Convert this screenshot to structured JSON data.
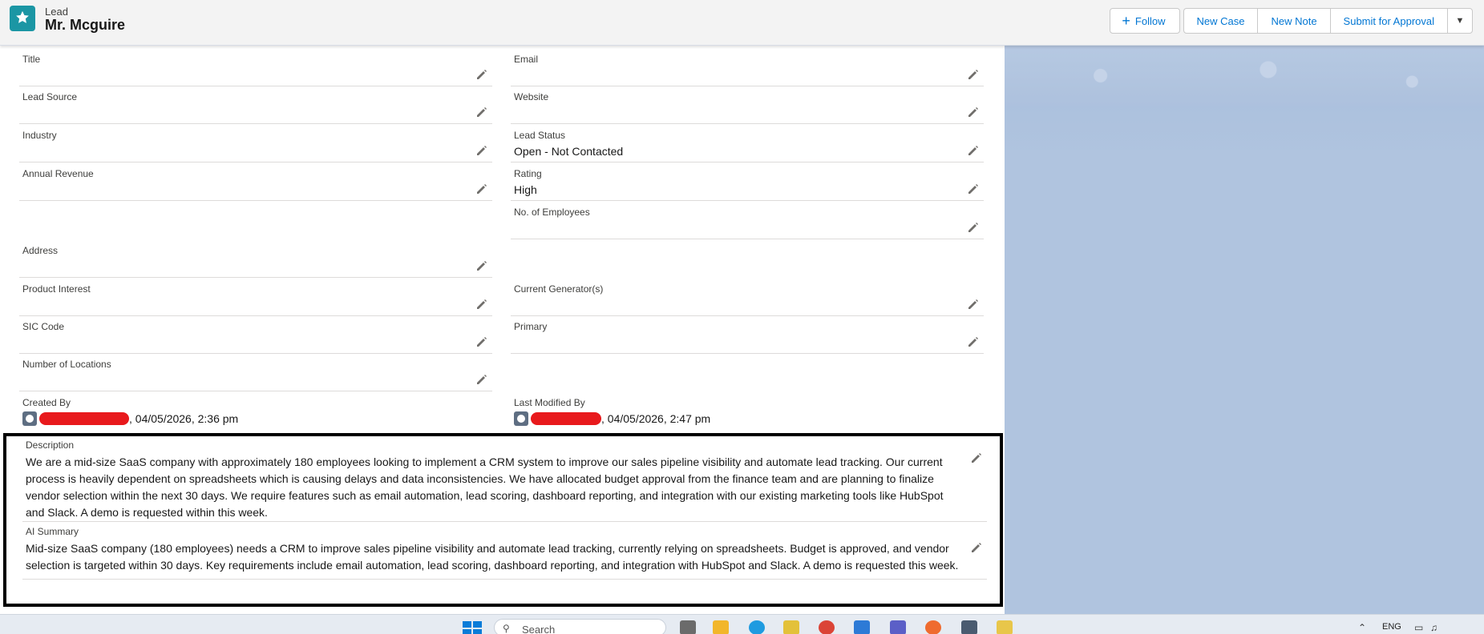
{
  "header": {
    "object_label": "Lead",
    "record_name": "Mr. Mcguire",
    "follow_label": "Follow",
    "new_case_label": "New Case",
    "new_note_label": "New Note",
    "submit_label": "Submit for Approval"
  },
  "fields_left": [
    {
      "label": "Title",
      "value": ""
    },
    {
      "label": "Lead Source",
      "value": ""
    },
    {
      "label": "Industry",
      "value": ""
    },
    {
      "label": "Annual Revenue",
      "value": ""
    },
    {
      "label": "Address",
      "value": ""
    },
    {
      "label": "Product Interest",
      "value": ""
    },
    {
      "label": "SIC Code",
      "value": ""
    },
    {
      "label": "Number of Locations",
      "value": ""
    }
  ],
  "fields_right": [
    {
      "label": "Email",
      "value": ""
    },
    {
      "label": "Website",
      "value": ""
    },
    {
      "label": "Lead Status",
      "value": "Open - Not Contacted"
    },
    {
      "label": "Rating",
      "value": "High"
    },
    {
      "label": "No. of Employees",
      "value": ""
    },
    {
      "label": "Current Generator(s)",
      "value": ""
    },
    {
      "label": "Primary",
      "value": ""
    }
  ],
  "created_by": {
    "label": "Created By",
    "date": ", 04/05/2026, 2:36 pm"
  },
  "modified_by": {
    "label": "Last Modified By",
    "date": ", 04/05/2026, 2:47 pm"
  },
  "description": {
    "label": "Description",
    "text": "We are a mid-size SaaS company with approximately 180 employees looking to implement a CRM system to improve our sales pipeline visibility and automate lead tracking. Our current process is heavily dependent on spreadsheets which is causing delays and data inconsistencies. We have allocated budget approval from the finance team and are planning to finalize vendor selection within the next 30 days. We require features such as email automation, lead scoring, dashboard reporting, and integration with our existing marketing tools like HubSpot and Slack. A demo is requested within this week."
  },
  "ai_summary": {
    "label": "AI Summary",
    "text": "Mid-size SaaS company (180 employees) needs a CRM to improve sales pipeline visibility and automate lead tracking, currently relying on spreadsheets. Budget is approved, and vendor selection is targeted within 30 days. Key requirements include email automation, lead scoring, dashboard reporting, and integration with HubSpot and Slack. A demo is requested this week."
  },
  "taskbar": {
    "search_placeholder": "Search",
    "language": "ENG"
  },
  "colors": {
    "brand": "#0176d3",
    "lead_icon": "#1b96a4",
    "redaction": "#e8191c"
  }
}
